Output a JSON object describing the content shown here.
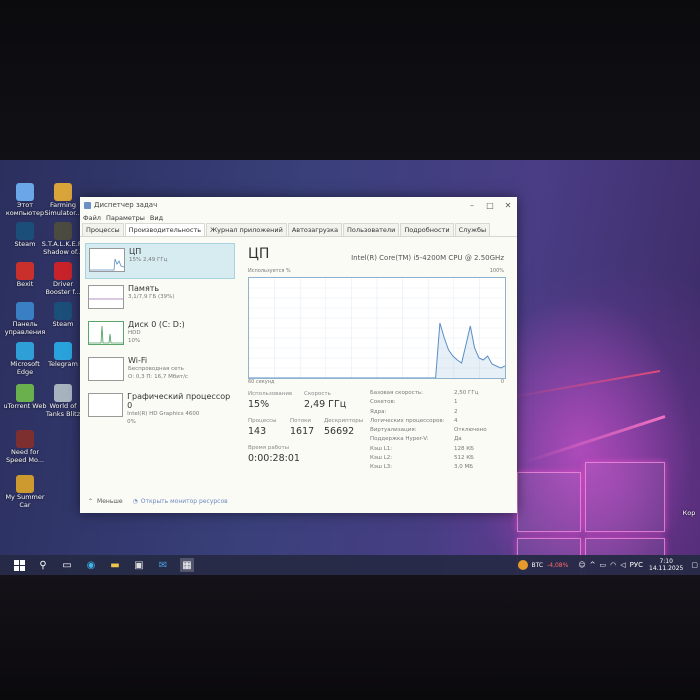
{
  "desktop_icons": [
    {
      "label": "Этот компьютер",
      "color": "#6aa6e8"
    },
    {
      "label": "Farming Simulator...",
      "color": "#d9a43a"
    },
    {
      "label": "Steam",
      "color": "#1b4f7a"
    },
    {
      "label": "S.T.A.L.K.E.R. Shadow of...",
      "color": "#4b4b3f"
    },
    {
      "label": "Bexit",
      "color": "#c9302c"
    },
    {
      "label": "Driver Booster f...",
      "color": "#c8232a"
    },
    {
      "label": "Панель управления",
      "color": "#3a7fc4"
    },
    {
      "label": "Steam",
      "color": "#1b4f7a"
    },
    {
      "label": "Microsoft Edge",
      "color": "#2f9fd8"
    },
    {
      "label": "Telegram",
      "color": "#2aa3dd"
    },
    {
      "label": "uTorrent Web",
      "color": "#6ab04c"
    },
    {
      "label": "World of Tanks Blitz",
      "color": "#a8b3c0"
    },
    {
      "label": "Need for Speed Mo...",
      "color": "#7d2f2f"
    },
    {
      "label": "My Summer Car",
      "color": "#cc9a2e"
    }
  ],
  "window": {
    "title": "Диспетчер задач",
    "menu": [
      "Файл",
      "Параметры",
      "Вид"
    ],
    "tabs": [
      "Процессы",
      "Производительность",
      "Журнал приложений",
      "Автозагрузка",
      "Пользователи",
      "Подробности",
      "Службы"
    ],
    "active_tab": "Производительность",
    "sidebar": [
      {
        "name": "ЦП",
        "detail": "15% 2,49 ГГц"
      },
      {
        "name": "Память",
        "detail": "3,1/7,9 ГБ (39%)"
      },
      {
        "name": "Диск 0 (C: D:)",
        "detail": "HDD",
        "detail2": "10%"
      },
      {
        "name": "Wi-Fi",
        "detail": "Беспроводная сеть",
        "detail2": "О: 0,3 П: 16,7 Мбит/с"
      },
      {
        "name": "Графический процессор 0",
        "detail": "Intel(R) HD Graphics 4600",
        "detail2": "0%"
      }
    ],
    "main": {
      "title": "ЦП",
      "cpu_name": "Intel(R) Core(TM) i5-4200M CPU @ 2.50GHz",
      "graph_label": "Используется %",
      "graph_max": "100%",
      "graph_time": "60 секунд",
      "graph_min": "0",
      "cpu_series": [
        0,
        0,
        0,
        0,
        0,
        0,
        0,
        0,
        0,
        0,
        0,
        0,
        0,
        0,
        0,
        0,
        0,
        0,
        0,
        0,
        0,
        0,
        0,
        0,
        0,
        0,
        0,
        0,
        0,
        0,
        0,
        0,
        0,
        0,
        0,
        0,
        0,
        0,
        0,
        0,
        0,
        0,
        0,
        0,
        55,
        40,
        28,
        22,
        18,
        15,
        33,
        52,
        30,
        20,
        18,
        22,
        14,
        12,
        10,
        12
      ]
    },
    "stats": {
      "utilization_label": "Использование",
      "utilization": "15%",
      "speed_label": "Скорость",
      "speed": "2,49 ГГц",
      "processes_label": "Процессы",
      "processes": "143",
      "threads_label": "Потоки",
      "threads": "1617",
      "handles_label": "Дескрипторы",
      "handles": "56692",
      "uptime_label": "Время работы",
      "uptime": "0:00:28:01"
    },
    "info": [
      {
        "k": "Базовая скорость:",
        "v": "2,50 ГГц"
      },
      {
        "k": "Сокетов:",
        "v": "1"
      },
      {
        "k": "Ядра:",
        "v": "2"
      },
      {
        "k": "Логических процессоров:",
        "v": "4"
      },
      {
        "k": "Виртуализация:",
        "v": "Отключено"
      },
      {
        "k": "Поддержка Hyper-V:",
        "v": "Да"
      },
      {
        "k": "Кэш L1:",
        "v": "128 КБ"
      },
      {
        "k": "Кэш L2:",
        "v": "512 КБ"
      },
      {
        "k": "Кэш L3:",
        "v": "3,0 МБ"
      }
    ],
    "footer": {
      "less": "Меньше",
      "monitor": "Открыть монитор ресурсов"
    }
  },
  "taskbar": {
    "btc_label": "BTC",
    "btc_change": "-4,08%",
    "language": "РУС",
    "time": "7:10",
    "date": "14.11.2025",
    "right_edge_label": "Кор"
  },
  "colors": {
    "accent": "#d7ecf1",
    "graph": "#8fb3cf",
    "btc_negative": "#ff6a6a"
  }
}
